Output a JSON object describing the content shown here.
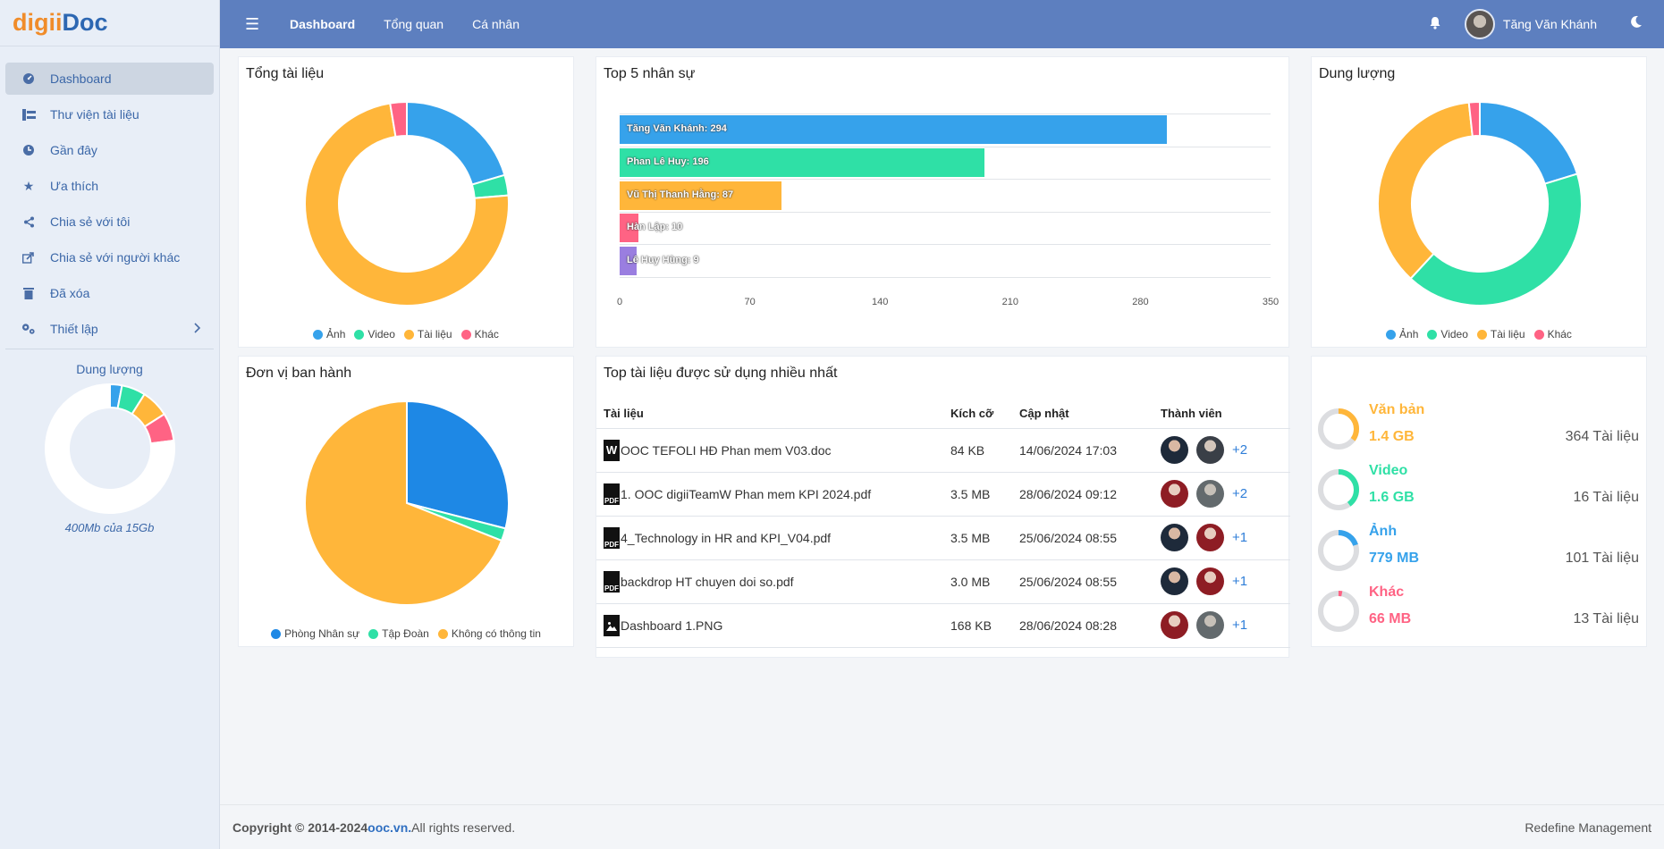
{
  "brand": {
    "part1": "digii",
    "part2": "Doc"
  },
  "sidebar": {
    "items": [
      {
        "label": "Dashboard",
        "icon": "dashboard-icon"
      },
      {
        "label": "Thư viện tài liệu",
        "icon": "library-icon"
      },
      {
        "label": "Gần đây",
        "icon": "clock-icon"
      },
      {
        "label": "Ưa thích",
        "icon": "star-icon"
      },
      {
        "label": "Chia sẻ với tôi",
        "icon": "share-icon"
      },
      {
        "label": "Chia sẻ với người khác",
        "icon": "share-out-icon"
      },
      {
        "label": "Đã xóa",
        "icon": "trash-icon"
      },
      {
        "label": "Thiết lập",
        "icon": "settings-icon"
      }
    ],
    "storage": {
      "title": "Dung lượng",
      "subtitle": "400Mb của 15Gb"
    }
  },
  "topbar": {
    "nav": [
      "Dashboard",
      "Tổng quan",
      "Cá nhân"
    ],
    "user": "Tăng Văn Khánh"
  },
  "cards": {
    "total_docs": {
      "title": "Tổng tài liệu",
      "legend": [
        "Ảnh",
        "Video",
        "Tài liệu",
        "Khác"
      ]
    },
    "top5": {
      "title": "Top 5 nhân sự"
    },
    "capacity": {
      "title": "Dung lượng",
      "legend": [
        "Ảnh",
        "Video",
        "Tài liệu",
        "Khác"
      ]
    },
    "issuers": {
      "title": "Đơn vị ban hành",
      "legend": [
        "Phòng Nhân sự",
        "Tập Đoàn",
        "Không có thông tin"
      ]
    },
    "top_docs": {
      "title": "Top tài liệu được sử dụng nhiều nhất"
    }
  },
  "colors": {
    "blue": "#36a2eb",
    "green": "#2fe0a6",
    "orange": "#ffb63a",
    "red": "#ff6384",
    "purple": "#9a7ee0"
  },
  "chart_data": [
    {
      "type": "pie",
      "title": "Tổng tài liệu",
      "categories": [
        "Ảnh",
        "Video",
        "Tài liệu",
        "Khác"
      ],
      "values": [
        101,
        16,
        364,
        13
      ]
    },
    {
      "type": "bar",
      "title": "Top 5 nhân sự",
      "categories": [
        "Tăng Văn Khánh",
        "Phan Lê Huy",
        "Vũ Thị Thanh Hằng",
        "Hàn Lập",
        "Lê Huy Hùng"
      ],
      "values": [
        294,
        196,
        87,
        10,
        9
      ],
      "xlim": [
        0,
        350
      ],
      "xticks": [
        0,
        70,
        140,
        210,
        280,
        350
      ],
      "labels": [
        "Tăng Văn Khánh: 294",
        "Phan Lê Huy: 196",
        "Vũ Thị Thanh Hằng: 87",
        "Hàn Lập: 10",
        "Lê Huy Hùng: 9"
      ]
    },
    {
      "type": "pie",
      "title": "Dung lượng",
      "categories": [
        "Ảnh",
        "Video",
        "Tài liệu",
        "Khác"
      ],
      "values": [
        779,
        1600,
        1400,
        66
      ]
    },
    {
      "type": "pie",
      "title": "Đơn vị ban hành",
      "categories": [
        "Phòng Nhân sự",
        "Tập Đoàn",
        "Không có thông tin"
      ],
      "values": [
        29,
        2,
        69
      ]
    }
  ],
  "table": {
    "headers": [
      "Tài liệu",
      "Kích cỡ",
      "Cập nhật",
      "Thành viên"
    ],
    "rows": [
      {
        "type": "W",
        "name": "OOC TEFOLI HĐ Phan mem V03.doc",
        "size": "84 KB",
        "updated": "14/06/2024 17:03",
        "more": "+2"
      },
      {
        "type": "PDF",
        "name": "1. OOC digiiTeamW Phan mem KPI 2024.pdf",
        "size": "3.5 MB",
        "updated": "28/06/2024 09:12",
        "more": "+2"
      },
      {
        "type": "PDF",
        "name": "4_Technology in HR and KPI_V04.pdf",
        "size": "3.5 MB",
        "updated": "25/06/2024 08:55",
        "more": "+1"
      },
      {
        "type": "PDF",
        "name": "backdrop HT chuyen doi so.pdf",
        "size": "3.0 MB",
        "updated": "25/06/2024 08:55",
        "more": "+1"
      },
      {
        "type": "",
        "name": "Dashboard 1.PNG",
        "size": "168 KB",
        "updated": "28/06/2024 08:28",
        "more": "+1"
      }
    ]
  },
  "storage_list": [
    {
      "name": "Văn bản",
      "size": "1.4 GB",
      "count": "364 Tài liệu",
      "color": "#ffb63a",
      "fraction": 0.35
    },
    {
      "name": "Video",
      "size": "1.6 GB",
      "count": "16 Tài liệu",
      "color": "#2fe0a6",
      "fraction": 0.4
    },
    {
      "name": "Ảnh",
      "size": "779 MB",
      "count": "101 Tài liệu",
      "color": "#36a2eb",
      "fraction": 0.2
    },
    {
      "name": "Khác",
      "size": "66 MB",
      "count": "13 Tài liệu",
      "color": "#ff6384",
      "fraction": 0.03
    }
  ],
  "footer": {
    "copy": "Copyright © 2014-2024 ",
    "link": "ooc.vn.",
    "rights": "All rights reserved.",
    "right": "Redefine Management"
  }
}
